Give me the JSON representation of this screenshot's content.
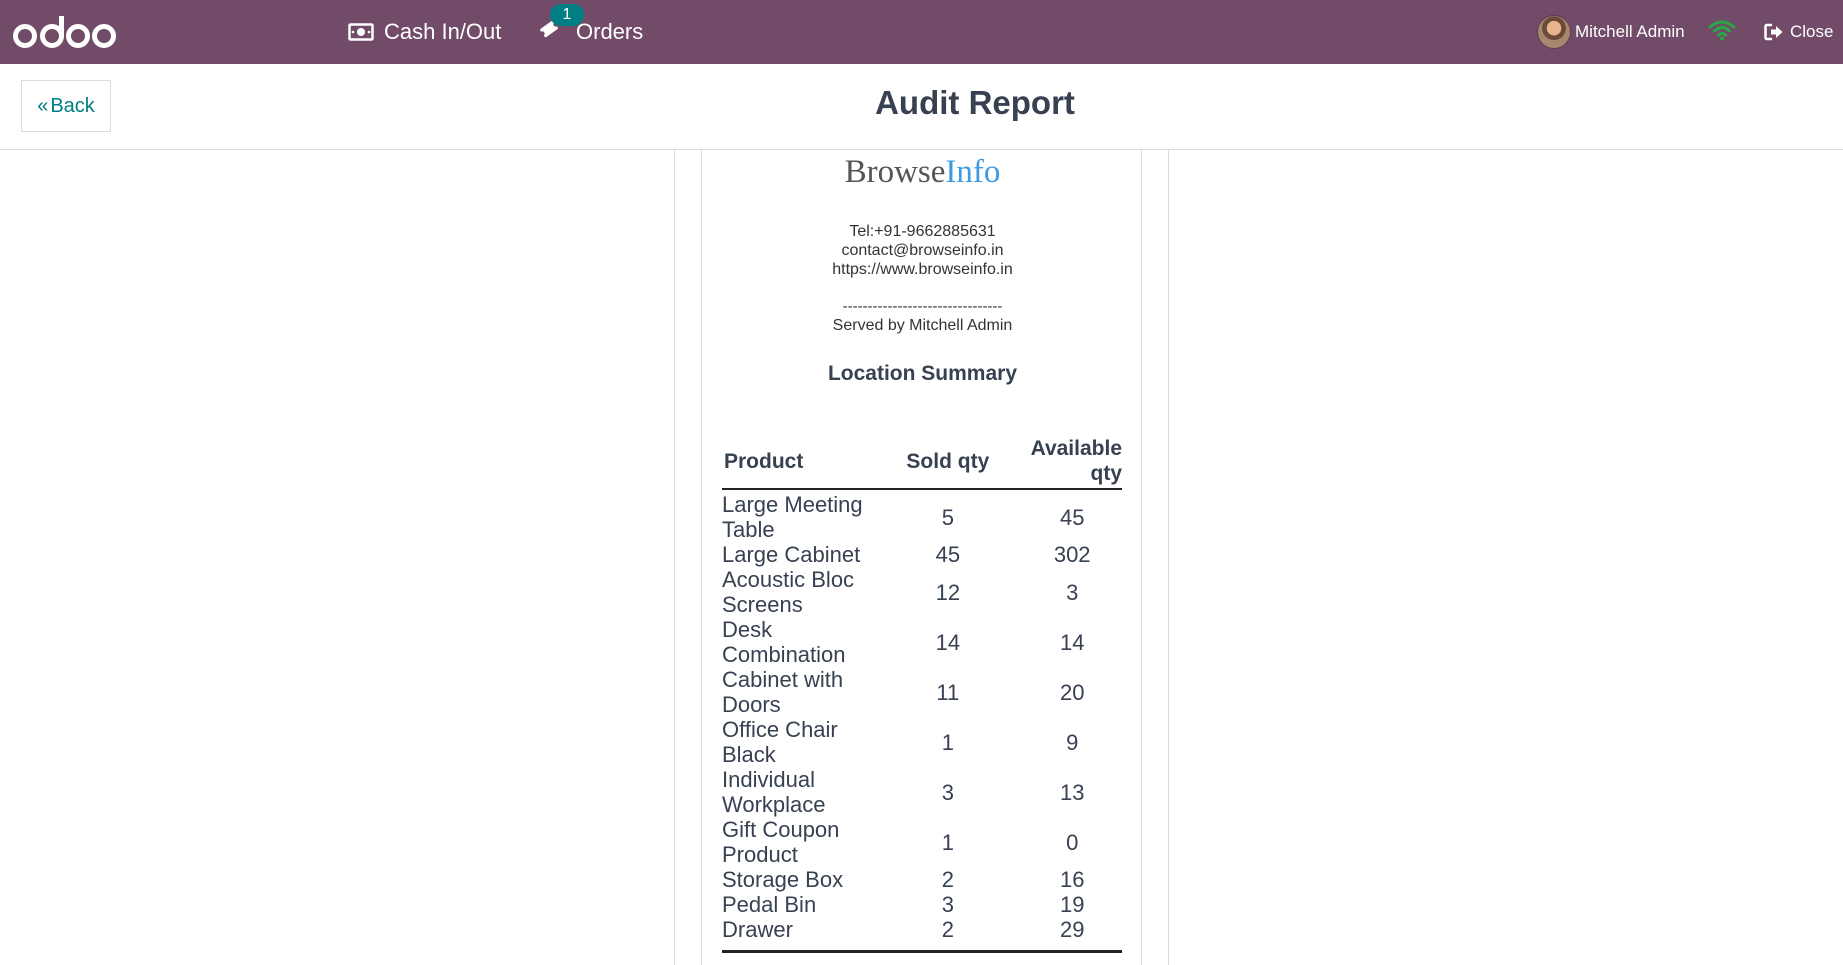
{
  "navbar": {
    "logo_text": "odoo",
    "cash_label": "Cash In/Out",
    "orders_label": "Orders",
    "orders_badge": "1",
    "user_name": "Mitchell Admin",
    "close_label": "Close",
    "bg_color": "#714B67",
    "badge_color": "#017E84",
    "wifi_color": "#28a745"
  },
  "header": {
    "back_label": "Back",
    "title": "Audit Report"
  },
  "receipt": {
    "brand_a": "Browse",
    "brand_b": "Info",
    "tel": "Tel:+91-9662885631",
    "email": "contact@browseinfo.in",
    "website": "https://www.browseinfo.in",
    "separator": "--------------------------------",
    "served_by": "Served by Mitchell Admin",
    "section_title": "Location Summary",
    "columns": {
      "product": "Product",
      "sold": "Sold qty",
      "available": "Available qty"
    },
    "rows": [
      {
        "product": "Large Meeting Table",
        "sold": "5",
        "available": "45"
      },
      {
        "product": "Large Cabinet",
        "sold": "45",
        "available": "302"
      },
      {
        "product": "Acoustic Bloc Screens",
        "sold": "12",
        "available": "3"
      },
      {
        "product": "Desk Combination",
        "sold": "14",
        "available": "14"
      },
      {
        "product": "Cabinet with Doors",
        "sold": "11",
        "available": "20"
      },
      {
        "product": "Office Chair Black",
        "sold": "1",
        "available": "9"
      },
      {
        "product": "Individual Workplace",
        "sold": "3",
        "available": "13"
      },
      {
        "product": "Gift Coupon Product",
        "sold": "1",
        "available": "0"
      },
      {
        "product": "Storage Box",
        "sold": "2",
        "available": "16"
      },
      {
        "product": "Pedal Bin",
        "sold": "3",
        "available": "19"
      },
      {
        "product": "Drawer",
        "sold": "2",
        "available": "29"
      }
    ]
  }
}
